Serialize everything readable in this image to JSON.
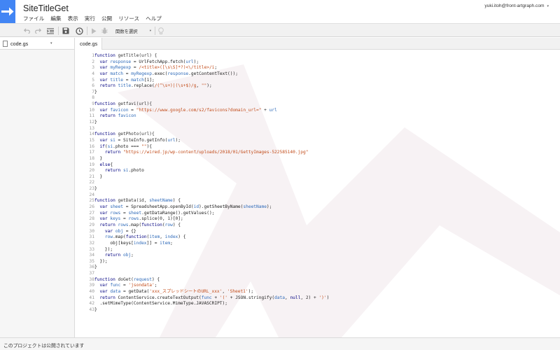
{
  "app": {
    "title": "SiteTitleGet",
    "logo": "apps-script-arrow-icon"
  },
  "account": {
    "email": "yuki.itoh@front-artgraph.com",
    "caret": "▾"
  },
  "menu": [
    "ファイル",
    "編集",
    "表示",
    "実行",
    "公開",
    "リソース",
    "ヘルプ"
  ],
  "toolbar": {
    "icons": [
      "undo-icon",
      "redo-icon",
      "indent-icon",
      "save-icon",
      "triggers-clock-icon",
      "run-icon",
      "debug-icon",
      "lightbulb-icon"
    ],
    "function_select": "関数を選択",
    "select_arrow": "▾"
  },
  "file_panel": {
    "selected_file": "code.gs",
    "arrow": "▾"
  },
  "tabs": [
    {
      "label": "code.gs",
      "active": true
    }
  ],
  "editor": {
    "lines": [
      [
        [
          "k",
          "function "
        ],
        [
          "n",
          "getTitle(url) {"
        ]
      ],
      [
        [
          "p",
          "  "
        ],
        [
          "k",
          "var "
        ],
        [
          "v",
          "response"
        ],
        [
          "p",
          " = UrlFetchApp.fetch("
        ],
        [
          "v",
          "url"
        ],
        [
          "p",
          ");"
        ]
      ],
      [
        [
          "p",
          "  "
        ],
        [
          "k",
          "var "
        ],
        [
          "v",
          "myRegexp"
        ],
        [
          "p",
          " = "
        ],
        [
          "r",
          "/<title>([\\s\\S]*?)<\\/title>/i"
        ],
        [
          "p",
          ";"
        ]
      ],
      [
        [
          "p",
          "  "
        ],
        [
          "k",
          "var "
        ],
        [
          "v",
          "match"
        ],
        [
          "p",
          " = "
        ],
        [
          "v",
          "myRegexp"
        ],
        [
          "p",
          ".exec("
        ],
        [
          "v",
          "response"
        ],
        [
          "p",
          ".getContentText());"
        ]
      ],
      [
        [
          "p",
          "  "
        ],
        [
          "k",
          "var "
        ],
        [
          "v",
          "title"
        ],
        [
          "p",
          " = "
        ],
        [
          "v",
          "match"
        ],
        [
          "p",
          "["
        ],
        [
          "n",
          "1"
        ],
        [
          "p",
          "];"
        ]
      ],
      [
        [
          "p",
          "  "
        ],
        [
          "k",
          "return "
        ],
        [
          "v",
          "title"
        ],
        [
          "p",
          ".replace("
        ],
        [
          "r",
          "/(^\\s+)|(\\s+$)/g"
        ],
        [
          "p",
          ", "
        ],
        [
          "s",
          "\"\""
        ],
        [
          "p",
          ");"
        ]
      ],
      [
        [
          "p",
          "}"
        ]
      ],
      [],
      [
        [
          "k",
          "function "
        ],
        [
          "n",
          "getfavi(url){"
        ]
      ],
      [
        [
          "p",
          "  "
        ],
        [
          "k",
          "var "
        ],
        [
          "v",
          "favicon"
        ],
        [
          "p",
          " = "
        ],
        [
          "s",
          "\"https://www.google.com/s2/favicons?domain_url=\""
        ],
        [
          "p",
          " + "
        ],
        [
          "v",
          "url"
        ]
      ],
      [
        [
          "p",
          "  "
        ],
        [
          "k",
          "return "
        ],
        [
          "v",
          "favicon"
        ]
      ],
      [
        [
          "p",
          "}"
        ]
      ],
      [],
      [
        [
          "k",
          "function "
        ],
        [
          "n",
          "getPhoto(url){"
        ]
      ],
      [
        [
          "p",
          "  "
        ],
        [
          "k",
          "var "
        ],
        [
          "v",
          "si"
        ],
        [
          "p",
          " = SiteInfo.getInfo("
        ],
        [
          "v",
          "url"
        ],
        [
          "p",
          ");"
        ]
      ],
      [
        [
          "p",
          "  "
        ],
        [
          "k",
          "if"
        ],
        [
          "p",
          "("
        ],
        [
          "v",
          "si"
        ],
        [
          "p",
          ".photo === "
        ],
        [
          "s",
          "\"\""
        ],
        [
          "p",
          "){"
        ]
      ],
      [
        [
          "p",
          "    "
        ],
        [
          "k",
          "return "
        ],
        [
          "s",
          "\"https://wired.jp/wp-content/uploads/2018/01/GettyImages-522585140.jpg\""
        ]
      ],
      [
        [
          "p",
          "  }"
        ]
      ],
      [
        [
          "p",
          "  "
        ],
        [
          "k",
          "else"
        ],
        [
          "p",
          "{"
        ]
      ],
      [
        [
          "p",
          "    "
        ],
        [
          "k",
          "return "
        ],
        [
          "v",
          "si"
        ],
        [
          "p",
          ".photo"
        ]
      ],
      [
        [
          "p",
          "  }"
        ]
      ],
      [],
      [
        [
          "p",
          "}"
        ]
      ],
      [],
      [
        [
          "k",
          "function "
        ],
        [
          "n",
          "getData(id, "
        ],
        [
          "v",
          "sheetName"
        ],
        [
          "p",
          ") {"
        ]
      ],
      [
        [
          "p",
          "  "
        ],
        [
          "k",
          "var "
        ],
        [
          "v",
          "sheet"
        ],
        [
          "p",
          " = SpreadsheetApp.openById("
        ],
        [
          "v",
          "id"
        ],
        [
          "p",
          ").getSheetByName("
        ],
        [
          "v",
          "sheetName"
        ],
        [
          "p",
          ");"
        ]
      ],
      [
        [
          "p",
          "  "
        ],
        [
          "k",
          "var "
        ],
        [
          "v",
          "rows"
        ],
        [
          "p",
          " = "
        ],
        [
          "v",
          "sheet"
        ],
        [
          "p",
          ".getDataRange().getValues();"
        ]
      ],
      [
        [
          "p",
          "  "
        ],
        [
          "k",
          "var "
        ],
        [
          "v",
          "keys"
        ],
        [
          "p",
          " = "
        ],
        [
          "v",
          "rows"
        ],
        [
          "p",
          ".splice("
        ],
        [
          "n",
          "0"
        ],
        [
          "p",
          ", "
        ],
        [
          "n",
          "1"
        ],
        [
          "p",
          ")["
        ],
        [
          "n",
          "0"
        ],
        [
          "p",
          "];"
        ]
      ],
      [
        [
          "p",
          "  "
        ],
        [
          "k",
          "return "
        ],
        [
          "v",
          "rows"
        ],
        [
          "p",
          ".map("
        ],
        [
          "k",
          "function"
        ],
        [
          "p",
          "("
        ],
        [
          "v",
          "row"
        ],
        [
          "p",
          ") {"
        ]
      ],
      [
        [
          "p",
          "    "
        ],
        [
          "k",
          "var "
        ],
        [
          "v",
          "obj"
        ],
        [
          "p",
          " = {}"
        ]
      ],
      [
        [
          "p",
          "    "
        ],
        [
          "v",
          "row"
        ],
        [
          "p",
          ".map("
        ],
        [
          "k",
          "function"
        ],
        [
          "p",
          "("
        ],
        [
          "v",
          "item"
        ],
        [
          "p",
          ", "
        ],
        [
          "v",
          "index"
        ],
        [
          "p",
          ") {"
        ]
      ],
      [
        [
          "p",
          "      obj[keys["
        ],
        [
          "v",
          "index"
        ],
        [
          "p",
          "]] = "
        ],
        [
          "v",
          "item"
        ],
        [
          "p",
          ";"
        ]
      ],
      [
        [
          "p",
          "    });"
        ]
      ],
      [
        [
          "p",
          "    "
        ],
        [
          "k",
          "return "
        ],
        [
          "v",
          "obj"
        ],
        [
          "p",
          ";"
        ]
      ],
      [
        [
          "p",
          "  });"
        ]
      ],
      [
        [
          "p",
          "}"
        ]
      ],
      [],
      [
        [
          "k",
          "function "
        ],
        [
          "n",
          "doGet("
        ],
        [
          "v",
          "request"
        ],
        [
          "p",
          ") {"
        ]
      ],
      [
        [
          "p",
          "  "
        ],
        [
          "k",
          "var "
        ],
        [
          "v",
          "func"
        ],
        [
          "p",
          " = "
        ],
        [
          "s",
          "'jsondata'"
        ],
        [
          "p",
          ";"
        ]
      ],
      [
        [
          "p",
          "  "
        ],
        [
          "k",
          "var "
        ],
        [
          "v",
          "data"
        ],
        [
          "p",
          " = getData("
        ],
        [
          "s",
          "'xxx_スプレッドシートのURL_xxx'"
        ],
        [
          "p",
          ", "
        ],
        [
          "s",
          "'Sheet1'"
        ],
        [
          "p",
          ");"
        ]
      ],
      [
        [
          "p",
          "  "
        ],
        [
          "k",
          "return "
        ],
        [
          "p",
          "ContentService.createTextOutput("
        ],
        [
          "v",
          "func"
        ],
        [
          "p",
          " + "
        ],
        [
          "s",
          "'('"
        ],
        [
          "p",
          " + JSON.stringify("
        ],
        [
          "v",
          "data"
        ],
        [
          "p",
          ", "
        ],
        [
          "k",
          "null"
        ],
        [
          "p",
          ", "
        ],
        [
          "n",
          "2"
        ],
        [
          "p",
          ") + "
        ],
        [
          "s",
          "')'"
        ],
        [
          "p",
          ")"
        ]
      ],
      [
        [
          "p",
          "  .setMimeType(ContentService.MimeType.JAVASCRIPT);"
        ]
      ],
      [
        [
          "p",
          "}"
        ]
      ]
    ]
  },
  "status": {
    "text": "このプロジェクトは公開されています"
  }
}
